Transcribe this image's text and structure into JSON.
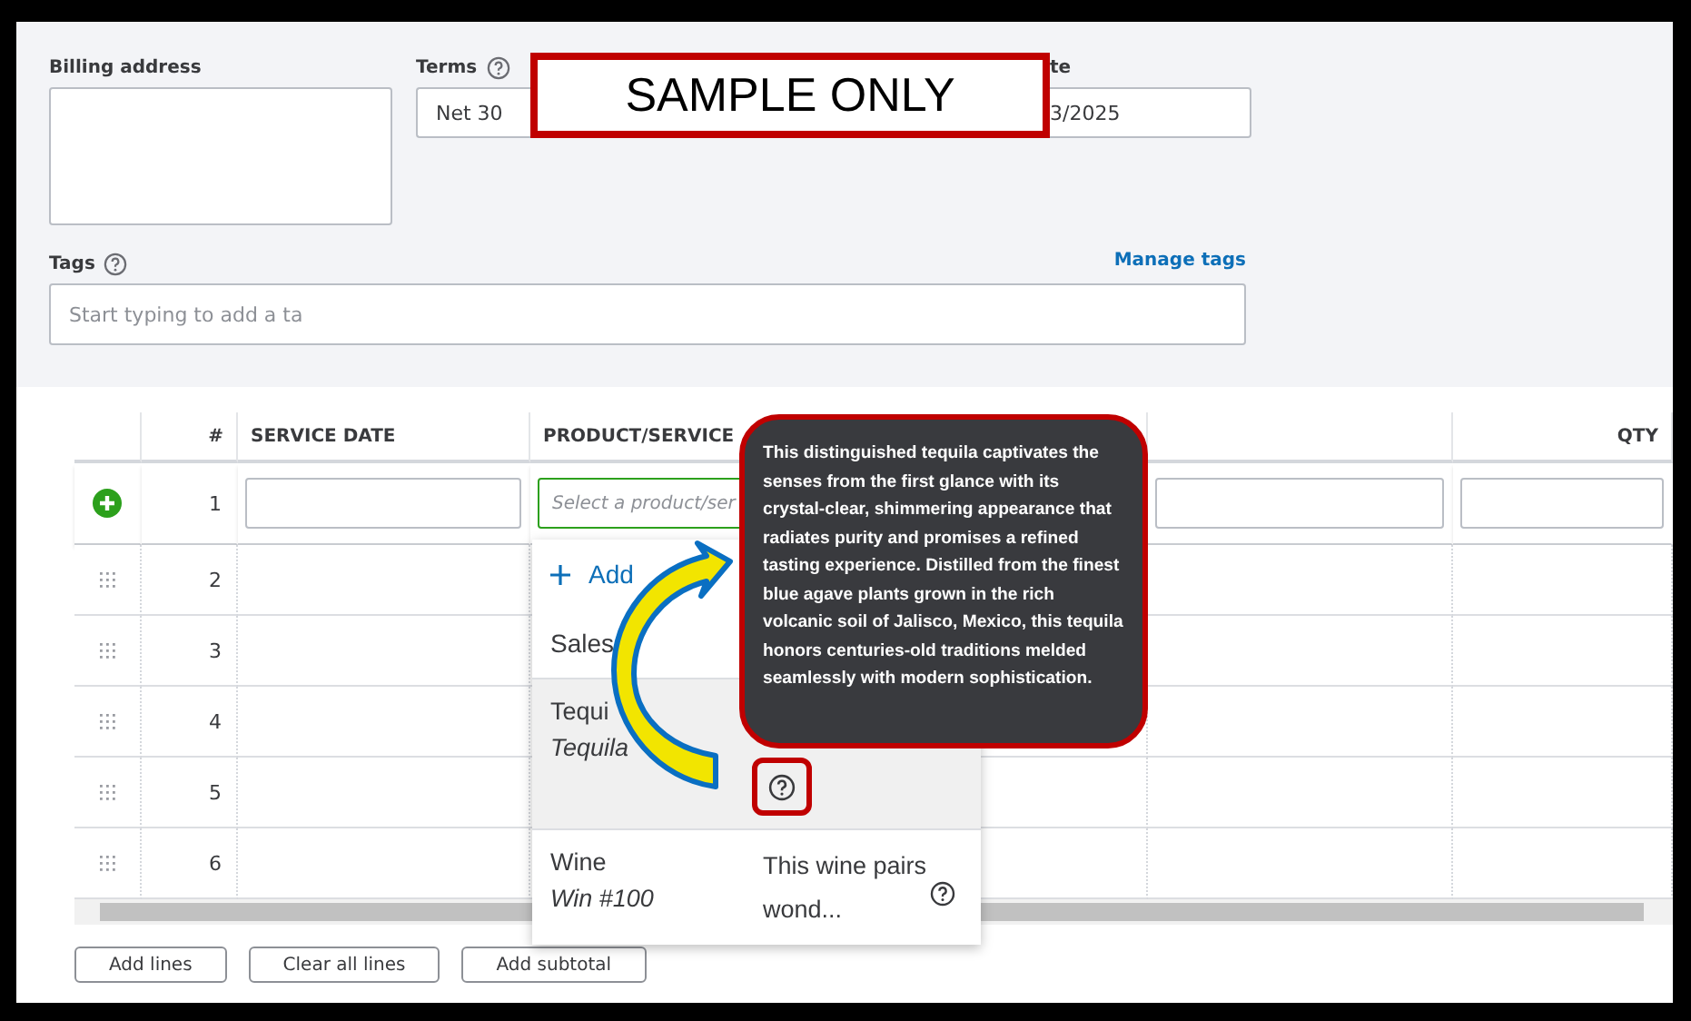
{
  "form": {
    "billing_address": {
      "label": "Billing address"
    },
    "terms": {
      "label": "Terms",
      "value": "Net 30"
    },
    "date": {
      "label": "te",
      "value": "3/2025"
    },
    "tags": {
      "label": "Tags",
      "placeholder": "Start typing to add a ta",
      "link": "Manage tags"
    }
  },
  "sample_label": "SAMPLE ONLY",
  "table": {
    "columns": [
      "#",
      "SERVICE DATE",
      "PRODUCT/SERVICE",
      "QTY"
    ],
    "product_placeholder": "Select a product/ser",
    "rows": [
      {
        "number": "1",
        "active": true
      },
      {
        "number": "2",
        "active": false
      },
      {
        "number": "3",
        "active": false
      },
      {
        "number": "4",
        "active": false
      },
      {
        "number": "5",
        "active": false
      },
      {
        "number": "6",
        "active": false
      }
    ]
  },
  "dropdown": {
    "add_label": "Add",
    "section": "Sales",
    "items": [
      {
        "name": "Tequi",
        "sku": "Tequila",
        "selected": true
      },
      {
        "name": "Wine",
        "sku": "Win #100",
        "description": "This wine pairs wond...",
        "selected": false
      }
    ]
  },
  "tooltip": {
    "text": "This distinguished tequila captivates the senses from the first glance with its crystal-clear, shimmering appearance that radiates purity and promises a refined tasting experience. Distilled from the finest blue agave plants grown in the rich volcanic soil of Jalisco, Mexico, this tequila honors centuries-old traditions melded seamlessly with modern sophistication."
  },
  "buttons": [
    "Add lines",
    "Clear all lines",
    "Add subtotal"
  ]
}
